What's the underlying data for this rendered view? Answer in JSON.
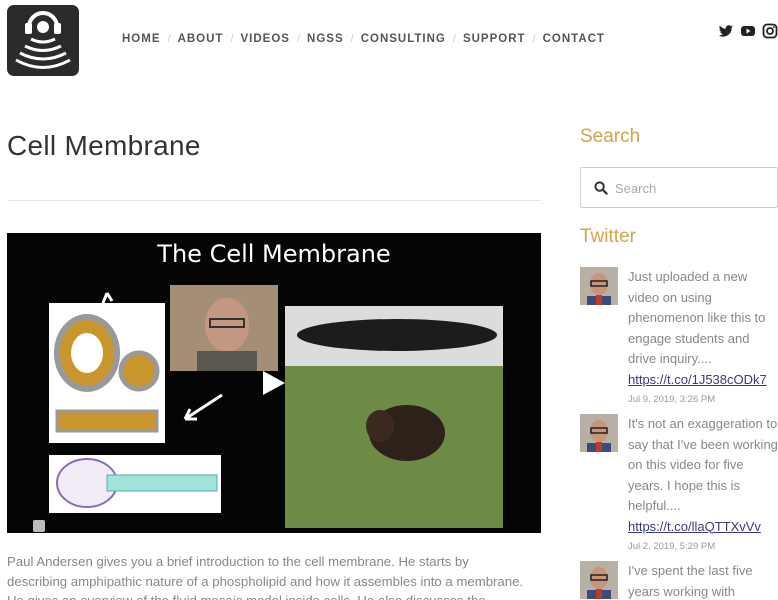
{
  "header": {
    "nav": [
      "HOME",
      "ABOUT",
      "VIDEOS",
      "NGSS",
      "CONSULTING",
      "SUPPORT",
      "CONTACT"
    ],
    "social_icons": [
      "twitter-icon",
      "youtube-icon",
      "instagram-icon"
    ]
  },
  "main": {
    "title": "Cell Membrane",
    "video_title": "The Cell Membrane",
    "description": "Paul Andersen gives you a brief introduction to the cell membrane. He starts by describing amphipathic nature of a phospholipid and how it assembles into a membrane. He gives an overview of the fluid mosaic model inside cells. He also discusses the movement of material"
  },
  "sidebar": {
    "search_heading": "Search",
    "search_placeholder": "Search",
    "twitter_heading": "Twitter",
    "tweets": [
      {
        "text": "Just uploaded a new video on using phenomenon like this to engage students and drive inquiry....",
        "link": "https://t.co/1J538cODk7",
        "date": "Jul 9, 2019, 3:26 PM"
      },
      {
        "text": "It's not an exaggeration to say that I've been working on this video for five years. I hope this is helpful....",
        "link": "https://t.co/llaQTTXvVv",
        "date": "Jul 2, 2019, 5:29 PM"
      },
      {
        "text": "I've spent the last five years working with",
        "link": "",
        "date": ""
      }
    ]
  }
}
